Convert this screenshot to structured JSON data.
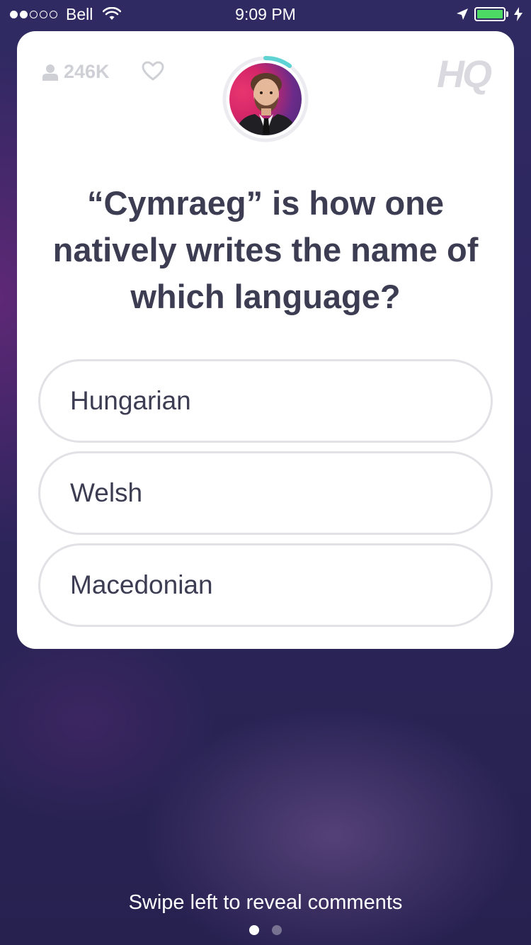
{
  "status_bar": {
    "carrier": "Bell",
    "time": "9:09 PM",
    "signal_bars": 2,
    "signal_total": 5,
    "battery_level": 1.0
  },
  "card": {
    "viewer_count": "246K",
    "logo_text": "HQ",
    "question": "“Cymraeg” is how one natively writes the name of which language?",
    "answers": [
      {
        "label": "Hungarian"
      },
      {
        "label": "Welsh"
      },
      {
        "label": "Macedonian"
      }
    ],
    "timer_remaining": 0.1
  },
  "footer": {
    "swipe_hint": "Swipe left to reveal comments",
    "page_count": 2,
    "active_page": 1
  },
  "colors": {
    "background": "#2e2660",
    "card": "#ffffff",
    "text_dark": "#3c3c53",
    "muted": "#cfd0d6",
    "timer_accent": "#5fd3d3",
    "battery": "#4cd964"
  }
}
